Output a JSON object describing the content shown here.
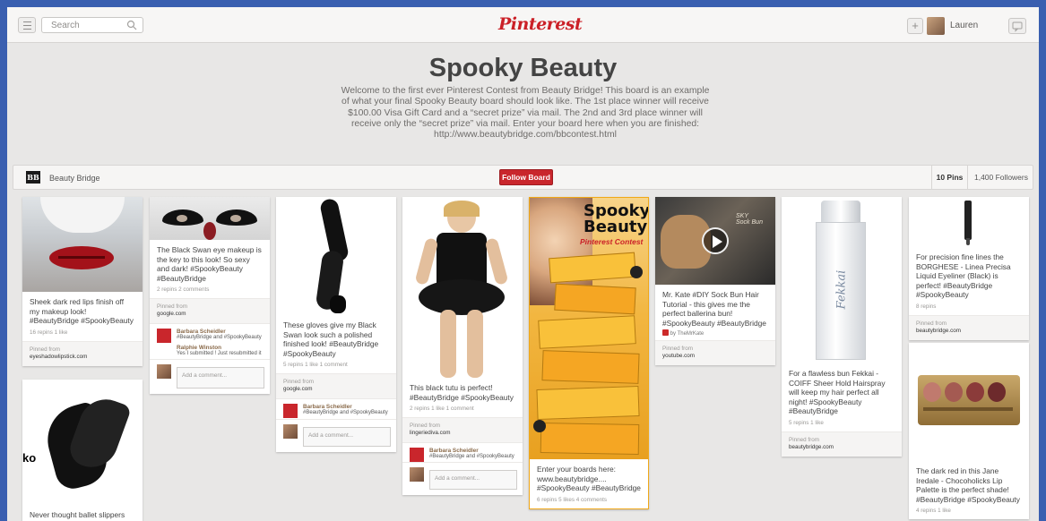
{
  "topbar": {
    "search_placeholder": "Search",
    "logo": "Pinterest",
    "username": "Lauren"
  },
  "board": {
    "title": "Spooky Beauty",
    "description": "Welcome to the first ever Pinterest Contest from Beauty Bridge! This board is an example of what your final Spooky Beauty board should look like. The 1st place winner will receive $100.00 Visa Gift Card and a “secret prize” via mail. The 2nd and 3rd place winner will receive only the “secret prize” via mail. Enter your board here when you are finished: http://www.beautybridge.com/bbcontest.html",
    "owner_logo": "BB",
    "owner_name": "Beauty Bridge",
    "follow_label": "Follow Board",
    "pins_count": "10 Pins",
    "followers_count": "1,400 Followers"
  },
  "common": {
    "pinned_from": "Pinned from",
    "add_comment": "Add a comment..."
  },
  "pins": [
    {
      "desc": "Sheek dark red lips finish off my makeup look! #BeautyBridge #SpookyBeauty",
      "stats": "16 repins   1 like",
      "source": "eyeshadowlipstick.com"
    },
    {
      "desc": "Never thought ballet slippers"
    },
    {
      "desc": "The Black Swan eye makeup is the key to this look! So sexy and dark! #SpookyBeauty #BeautyBridge",
      "stats": "2 repins   2 comments",
      "source": "google.com",
      "comments": [
        {
          "name": "Barbara Scheidler",
          "text": "#BeautyBridge and #SpookyBeauty"
        },
        {
          "name": "Ralphie Winston",
          "text": "Yes I submitted ! Just resubmitted it"
        }
      ]
    },
    {
      "desc": "These gloves give my Black Swan look such a polished finished look! #BeautyBridge #SpookyBeauty",
      "stats": "5 repins   1 like   1 comment",
      "source": "google.com",
      "comments": [
        {
          "name": "Barbara Scheidler",
          "text": "#BeautyBridge and #SpookyBeauty"
        }
      ]
    },
    {
      "desc": "This black tutu is perfect! #BeautyBridge #SpookyBeauty",
      "stats": "2 repins   1 like   1 comment",
      "source": "lingeriediva.com",
      "comments": [
        {
          "name": "Barbara Scheidler",
          "text": "#BeautyBridge and #SpookyBeauty"
        }
      ]
    },
    {
      "desc": "Enter your boards here: www.beautybridge.... #SpookyBeauty #BeautyBridge",
      "stats": "6 repins   5 likes   4 comments",
      "poster": {
        "title1": "Spooky",
        "title2": "Beauty",
        "brand": "Pinterest Contest"
      }
    },
    {
      "desc": "Mr. Kate #DIY Sock Bun Hair Tutorial - this gives me the perfect ballerina bun! #SpookyBeauty #BeautyBridge",
      "by": "by TheMrKate",
      "source": "youtube.com"
    },
    {
      "desc": "For a flawless bun Fekkai - COIFF Sheer Hold Hairspray will keep my hair perfect all night! #SpookyBeauty #BeautyBridge",
      "stats": "5 repins   1 like",
      "source": "beautybridge.com",
      "brand": "Fekkai"
    },
    {
      "desc": "For precision fine lines the BORGHESE - Linea Precisa Liquid Eyeliner (Black) is perfect! #BeautyBridge #SpookyBeauty",
      "stats": "8 repins",
      "source": "beautybridge.com"
    },
    {
      "desc": "The dark red in this Jane Iredale - Chocoholicks Lip Palette is the perfect shade! #BeautyBridge #SpookyBeauty",
      "stats": "4 repins   1 like"
    }
  ]
}
